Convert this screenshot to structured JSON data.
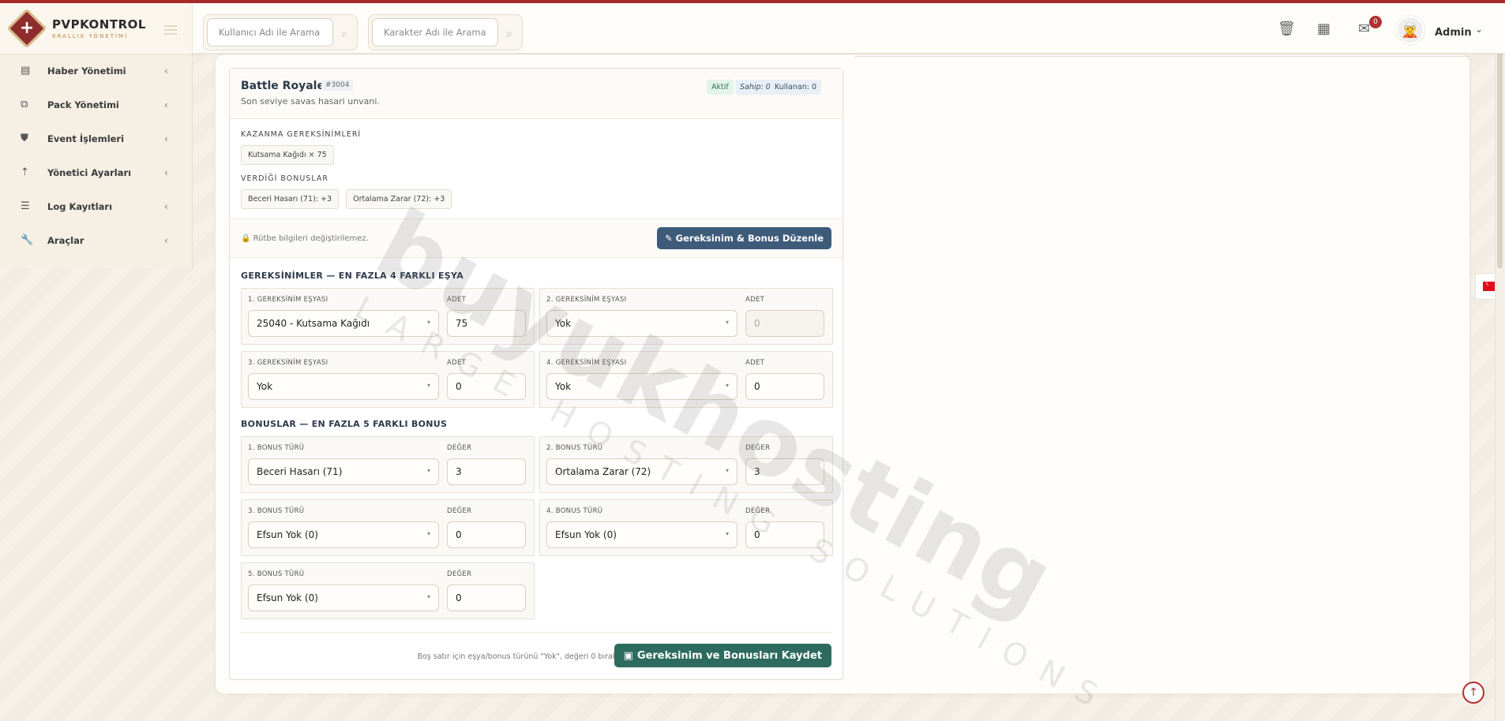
{
  "brand": {
    "title": "PVPKONTROL",
    "subtitle": "KRALLIK YÖNETİMİ"
  },
  "header": {
    "search_user_placeholder": "Kullanıcı Adı ile Arama",
    "search_char_placeholder": "Karakter Adı ile Arama",
    "notification_count": "0",
    "admin_name": "Admin"
  },
  "sidebar": {
    "items": [
      {
        "label": "Haber Yönetimi",
        "icon": "newspaper-icon"
      },
      {
        "label": "Pack Yönetimi",
        "icon": "package-icon"
      },
      {
        "label": "Event İşlemleri",
        "icon": "shield-icon"
      },
      {
        "label": "Yönetici Ayarları",
        "icon": "pin-icon"
      },
      {
        "label": "Log Kayıtları",
        "icon": "list-icon"
      },
      {
        "label": "Araçlar",
        "icon": "wrench-icon"
      }
    ]
  },
  "rank": {
    "title": "Battle Royale",
    "id": "#3004",
    "description": "Son seviye savas hasari unvani.",
    "status": "Aktif",
    "owner_label": "Sahip: 0",
    "user_label": "Kullanan: 0",
    "requirements_label": "KAZANMA GEREKSİNİMLERİ",
    "requirement_chips": [
      "Kutsama Kağıdı × 75"
    ],
    "bonuses_label": "VERDİĞİ BONUSLAR",
    "bonus_chips": [
      "Beceri Hasarı (71): +3",
      "Ortalama Zarar (72): +3"
    ],
    "lock_text": "Rütbe bilgileri değiştirilemez.",
    "edit_button": "Gereksinim & Bonus Düzenle"
  },
  "requirements_form": {
    "title": "GEREKSİNİMLER — EN FAZLA 4 FARKLI EŞYA",
    "rows": [
      {
        "label": "1. GEREKSİNİM EŞYASI",
        "qty_label": "ADET",
        "item": "25040 - Kutsama Kağıdı",
        "qty": "75"
      },
      {
        "label": "2. GEREKSİNİM EŞYASI",
        "qty_label": "ADET",
        "item": "Yok",
        "qty": "0"
      },
      {
        "label": "3. GEREKSİNİM EŞYASI",
        "qty_label": "ADET",
        "item": "Yok",
        "qty": "0"
      },
      {
        "label": "4. GEREKSİNİM EŞYASI",
        "qty_label": "ADET",
        "item": "Yok",
        "qty": "0"
      }
    ]
  },
  "bonuses_form": {
    "title": "BONUSLAR — EN FAZLA 5 FARKLI BONUS",
    "rows": [
      {
        "label": "1. BONUS TÜRÜ",
        "val_label": "DEĞER",
        "type": "Beceri Hasarı (71)",
        "value": "3"
      },
      {
        "label": "2. BONUS TÜRÜ",
        "val_label": "DEĞER",
        "type": "Ortalama Zarar (72)",
        "value": "3"
      },
      {
        "label": "3. BONUS TÜRÜ",
        "val_label": "DEĞER",
        "type": "Efsun Yok (0)",
        "value": "0"
      },
      {
        "label": "4. BONUS TÜRÜ",
        "val_label": "DEĞER",
        "type": "Efsun Yok (0)",
        "value": "0"
      },
      {
        "label": "5. BONUS TÜRÜ",
        "val_label": "DEĞER",
        "type": "Efsun Yok (0)",
        "value": "0"
      }
    ]
  },
  "footer": {
    "hint": "Boş satır için eşya/bonus türünü \"Yok\", değeri 0 bırakın.",
    "save_button": "Gereksinim ve Bonusları Kaydet"
  },
  "watermark": {
    "main": "buyukhosting",
    "sub": "LARGE HOSTING SOLUTIONS"
  },
  "colors": {
    "accent": "#a52a2a",
    "primary_btn": "#3e5b7a",
    "save_btn": "#2e6b5f"
  }
}
